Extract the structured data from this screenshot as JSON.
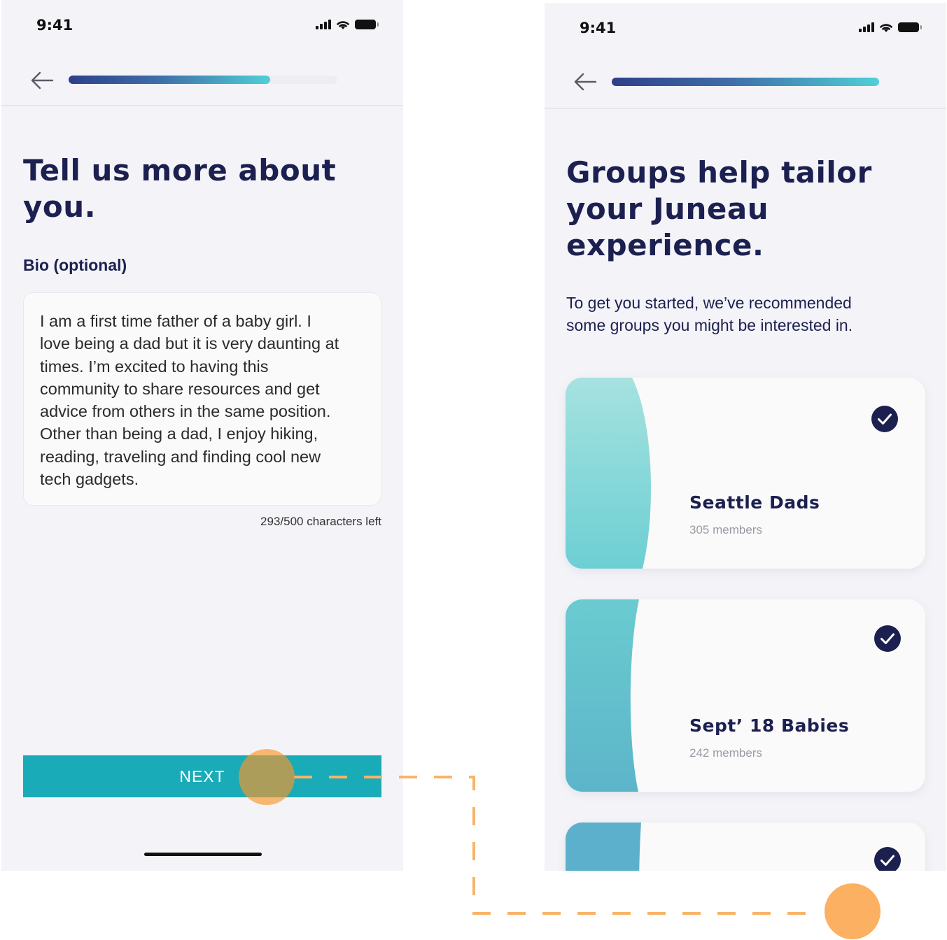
{
  "left_screen": {
    "status_time": "9:41",
    "progress": 0.75,
    "title_line1": "Tell us more about",
    "title_line2": "you.",
    "bio_label": "Bio (optional)",
    "bio_lines": [
      "I am a first time father of a  baby girl. I",
      "love being a dad but it is very daunting at",
      "times. I’m excited to having this",
      "community to share resources and get",
      "advice from others in the same position.",
      "Other than being a dad, I enjoy hiking,",
      "reading, traveling and finding cool new",
      "tech gadgets."
    ],
    "char_counter": "293/500 characters left",
    "next_label": "NEXT"
  },
  "right_screen": {
    "status_time": "9:41",
    "progress": 1.0,
    "title_line1": "Groups help tailor",
    "title_line2": "your Juneau",
    "title_line3": "experience.",
    "subtitle_line1": "To get you started, we’ve recommended",
    "subtitle_line2": "some groups you might be interested in.",
    "groups": [
      {
        "name": "Seattle Dads",
        "members": "305 members",
        "selected": true
      },
      {
        "name": "Sept’ 18 Babies",
        "members": "242 members",
        "selected": true
      },
      {
        "name": "",
        "members": "",
        "selected": true
      }
    ]
  },
  "colors": {
    "title": "#1c2050",
    "accent_button": "#1aabb8",
    "progress_start": "#2f3f8a",
    "progress_end": "#4fd0d8",
    "tap_indicator": "#fcb062",
    "check_fill": "#1c2050"
  },
  "icons": [
    "signal-icon",
    "wifi-icon",
    "battery-icon",
    "back-arrow-icon",
    "check-circle-icon"
  ]
}
